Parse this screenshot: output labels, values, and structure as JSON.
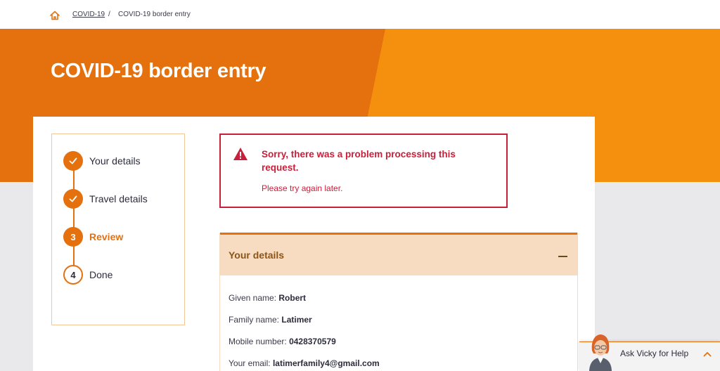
{
  "breadcrumb": {
    "home_icon": "home-icon",
    "link": "COVID-19",
    "separator": "/",
    "current": "COVID-19 border entry"
  },
  "hero": {
    "title": "COVID-19 border entry",
    "colors": {
      "dark": "#e4700e",
      "light": "#f5900f"
    }
  },
  "steps": [
    {
      "number": "1",
      "label": "Your details",
      "state": "done",
      "icon": "check-icon"
    },
    {
      "number": "2",
      "label": "Travel details",
      "state": "done",
      "icon": "check-icon"
    },
    {
      "number": "3",
      "label": "Review",
      "state": "active"
    },
    {
      "number": "4",
      "label": "Done",
      "state": "pending"
    }
  ],
  "error": {
    "icon": "warning-icon",
    "title": "Sorry, there was a problem processing this request.",
    "message": "Please try again later.",
    "color": "#c8203a"
  },
  "details": {
    "title": "Your details",
    "fields": [
      {
        "label": "Given name:",
        "value": "Robert"
      },
      {
        "label": "Family name:",
        "value": "Latimer"
      },
      {
        "label": "Mobile number:",
        "value": "0428370579"
      },
      {
        "label": "Your email:",
        "value": "latimerfamily4@gmail.com"
      }
    ]
  },
  "chat": {
    "label": "Ask Vicky for Help",
    "icon": "chevron-up-icon"
  }
}
